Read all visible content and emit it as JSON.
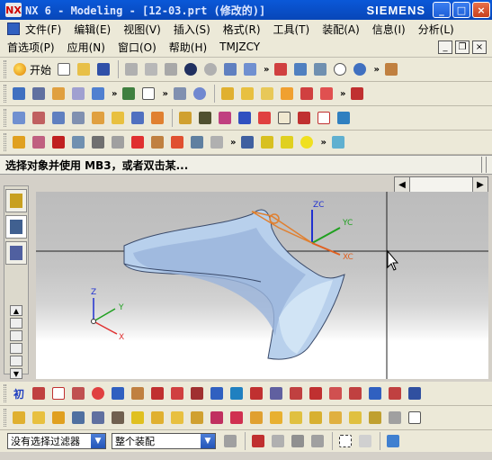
{
  "window": {
    "app_logo": "NX",
    "title": "NX 6 - Modeling - [12-03.prt (修改的)]",
    "brand": "SIEMENS",
    "min_label": "_",
    "max_label": "□",
    "close_label": "×"
  },
  "menu": {
    "row1": [
      "文件(F)",
      "编辑(E)",
      "视图(V)",
      "插入(S)",
      "格式(R)",
      "工具(T)",
      "装配(A)",
      "信息(I)",
      "分析(L)"
    ],
    "row2": [
      "首选项(P)",
      "应用(N)",
      "窗口(O)",
      "帮助(H)",
      "TMJZCY"
    ],
    "doc_min": "_",
    "doc_restore": "❐",
    "doc_close": "×"
  },
  "toolbar": {
    "start_label": "开始",
    "more": "»"
  },
  "cue": {
    "text": "选择对象并使用 MB3，或者双击某..."
  },
  "scroll": {
    "left_arrow": "◀",
    "right_arrow": "▶"
  },
  "viewport": {
    "work_csys": {
      "x": "XC",
      "y": "YC",
      "z": "ZC"
    },
    "abs_csys": {
      "x": "X",
      "y": "Y",
      "z": "Z"
    }
  },
  "bottom_toolbar": {
    "first_label": "初"
  },
  "status": {
    "filter_value": "没有选择过滤器",
    "scope_value": "整个装配"
  },
  "colors": {
    "title_bar": "#0a58d8",
    "workpiece": "#b8d0ec",
    "wcs_x": "#e06020",
    "wcs_y": "#20a020",
    "wcs_z": "#2030d0"
  }
}
